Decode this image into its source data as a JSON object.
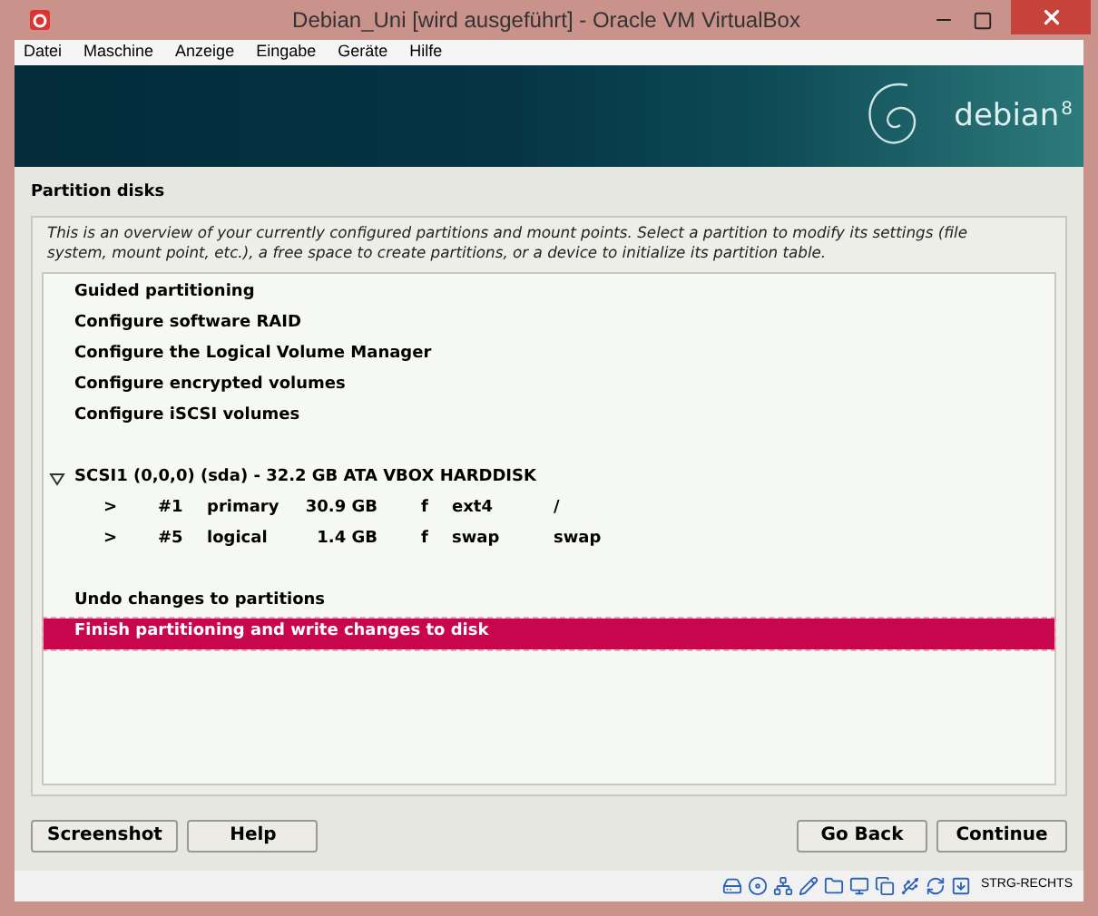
{
  "window": {
    "title": "Debian_Uni [wird ausgeführt] - Oracle VM VirtualBox"
  },
  "menu": [
    "Datei",
    "Maschine",
    "Anzeige",
    "Eingabe",
    "Geräte",
    "Hilfe"
  ],
  "banner": {
    "name": "debian",
    "version": "8"
  },
  "page_title": "Partition disks",
  "description": "This is an overview of your currently configured partitions and mount points. Select a partition to modify its settings (file system, mount point, etc.), a free space to create partitions, or a device to initialize its partition table.",
  "groups": [
    {
      "items": [
        {
          "kind": "action",
          "label": "Guided partitioning",
          "selected": false
        },
        {
          "kind": "action",
          "label": "Configure software RAID",
          "selected": false
        },
        {
          "kind": "action",
          "label": "Configure the Logical Volume Manager",
          "selected": false
        },
        {
          "kind": "action",
          "label": "Configure encrypted volumes",
          "selected": false
        },
        {
          "kind": "action",
          "label": "Configure iSCSI volumes",
          "selected": false
        }
      ]
    },
    {
      "items": [
        {
          "kind": "disk",
          "label": "SCSI1 (0,0,0) (sda) - 32.2 GB ATA VBOX HARDDISK",
          "expanded": true,
          "selected": false,
          "children": [
            {
              "kind": "partition",
              "marker": ">",
              "number": "#1",
              "type": "primary",
              "size": "30.9 GB",
              "flag": "f",
              "filesystem": "ext4",
              "mount": "/",
              "selected": false
            },
            {
              "kind": "partition",
              "marker": ">",
              "number": "#5",
              "type": "logical",
              "size": "1.4 GB",
              "flag": "f",
              "filesystem": "swap",
              "mount": "swap",
              "selected": false
            }
          ]
        }
      ]
    },
    {
      "items": [
        {
          "kind": "action",
          "label": "Undo changes to partitions",
          "selected": false
        },
        {
          "kind": "action",
          "label": "Finish partitioning and write changes to disk",
          "selected": true
        }
      ]
    }
  ],
  "buttons_left": [
    "Screenshot",
    "Help"
  ],
  "buttons_right": [
    "Go Back",
    "Continue"
  ],
  "status_bar": {
    "host_key": "STRG-RECHTS"
  }
}
